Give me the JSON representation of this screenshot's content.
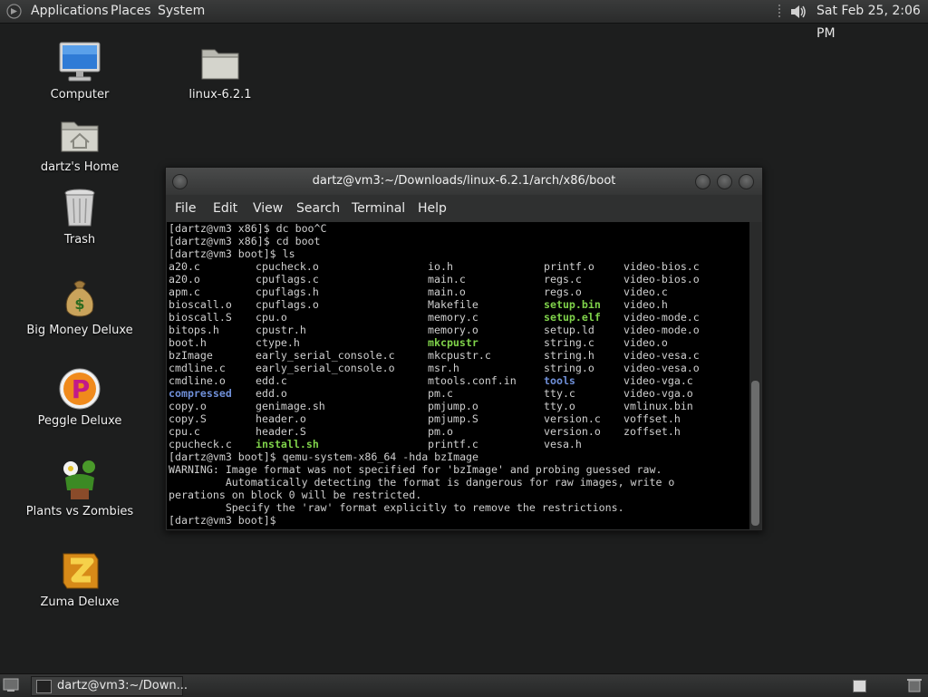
{
  "top_panel": {
    "menus": [
      "Applications",
      "Places",
      "System"
    ],
    "clock": "Sat Feb 25,  2:06 PM",
    "icons": [
      "gnome-foot-icon",
      "volume-icon"
    ]
  },
  "desktop": {
    "icons": [
      {
        "label": "Computer",
        "icon": "computer-icon"
      },
      {
        "label": "linux-6.2.1",
        "icon": "folder-icon"
      },
      {
        "label": "dartz's Home",
        "icon": "home-folder-icon"
      },
      {
        "label": "Trash",
        "icon": "trash-icon"
      },
      {
        "label": "Big Money Deluxe",
        "icon": "money-bag-icon"
      },
      {
        "label": "Peggle Deluxe",
        "icon": "peggle-icon"
      },
      {
        "label": "Plants vs Zombies",
        "icon": "plants-icon"
      },
      {
        "label": "Zuma Deluxe",
        "icon": "zuma-icon"
      }
    ]
  },
  "terminal": {
    "title": "dartz@vm3:~/Downloads/linux-6.2.1/arch/x86/boot",
    "menus": [
      "File",
      "Edit",
      "View",
      "Search",
      "Terminal",
      "Help"
    ],
    "lines_before": [
      "[dartz@vm3 x86]$ dc boo^C",
      "[dartz@vm3 x86]$ cd boot",
      "[dartz@vm3 boot]$ ls"
    ],
    "listing_columns": [
      [
        "a20.c",
        "a20.o",
        "apm.c",
        "bioscall.o",
        "bioscall.S",
        "bitops.h",
        "boot.h",
        "bzImage",
        "cmdline.c",
        "cmdline.o",
        "compressed",
        "copy.o",
        "copy.S",
        "cpu.c",
        "cpucheck.c"
      ],
      [
        "cpucheck.o",
        "cpuflags.c",
        "cpuflags.h",
        "cpuflags.o",
        "cpu.o",
        "cpustr.h",
        "ctype.h",
        "early_serial_console.c",
        "early_serial_console.o",
        "edd.c",
        "edd.o",
        "genimage.sh",
        "header.o",
        "header.S",
        "install.sh"
      ],
      [
        "io.h",
        "main.c",
        "main.o",
        "Makefile",
        "memory.c",
        "memory.o",
        "mkcpustr",
        "mkcpustr.c",
        "msr.h",
        "mtools.conf.in",
        "pm.c",
        "pmjump.o",
        "pmjump.S",
        "pm.o",
        "printf.c"
      ],
      [
        "printf.o",
        "regs.c",
        "regs.o",
        "setup.bin",
        "setup.elf",
        "setup.ld",
        "string.c",
        "string.h",
        "string.o",
        "tools",
        "tty.c",
        "tty.o",
        "version.c",
        "version.o",
        "vesa.h"
      ],
      [
        "video-bios.c",
        "video-bios.o",
        "video.c",
        "video.h",
        "video-mode.c",
        "video-mode.o",
        "video.o",
        "video-vesa.c",
        "video-vesa.o",
        "video-vga.c",
        "video-vga.o",
        "vmlinux.bin",
        "voffset.h",
        "zoffset.h",
        ""
      ]
    ],
    "highlight_green": [
      "setup.bin",
      "setup.elf",
      "mkcpustr",
      "install.sh"
    ],
    "highlight_blue": [
      "compressed",
      "tools"
    ],
    "lines_after": [
      "[dartz@vm3 boot]$ qemu-system-x86_64 -hda bzImage",
      "WARNING: Image format was not specified for 'bzImage' and probing guessed raw.",
      "         Automatically detecting the format is dangerous for raw images, write o",
      "perations on block 0 will be restricted.",
      "         Specify the 'raw' format explicitly to remove the restrictions.",
      "[dartz@vm3 boot]$ "
    ]
  },
  "bottom_panel": {
    "task_label": "dartz@vm3:~/Down..."
  }
}
